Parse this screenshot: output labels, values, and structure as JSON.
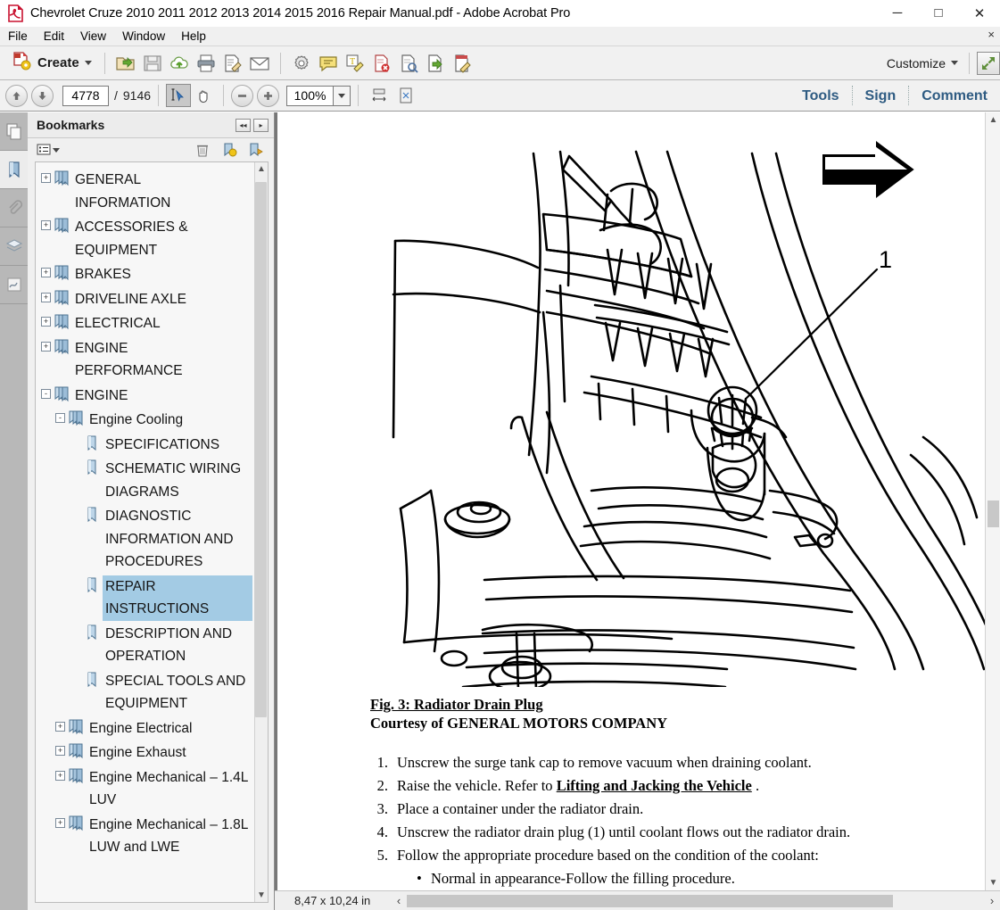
{
  "window": {
    "title": "Chevrolet Cruze 2010 2011 2012 2013 2014 2015 2016 Repair Manual.pdf - Adobe Acrobat Pro",
    "minimize": "─",
    "maximize": "□",
    "close": "✕"
  },
  "menubar": {
    "items": [
      {
        "label": "File"
      },
      {
        "label": "Edit"
      },
      {
        "label": "View"
      },
      {
        "label": "Window"
      },
      {
        "label": "Help"
      }
    ],
    "close_label": "×"
  },
  "toolbar": {
    "create_label": "Create",
    "customize_label": "Customize",
    "icons": [
      {
        "name": "open-file-icon"
      },
      {
        "name": "save-icon"
      },
      {
        "name": "upload-cloud-icon"
      },
      {
        "name": "print-icon"
      },
      {
        "name": "sign-document-icon"
      },
      {
        "name": "email-icon"
      },
      {
        "name": "gear-icon"
      },
      {
        "name": "comment-bubble-icon"
      },
      {
        "name": "highlight-text-icon"
      },
      {
        "name": "delete-page-icon"
      },
      {
        "name": "inspect-document-icon"
      },
      {
        "name": "export-document-icon"
      },
      {
        "name": "edit-document-icon"
      }
    ]
  },
  "navbar": {
    "page_current": "4778",
    "page_separator": "/",
    "page_total": "9146",
    "zoom_level": "100%",
    "links": [
      {
        "label": "Tools"
      },
      {
        "label": "Sign"
      },
      {
        "label": "Comment"
      }
    ]
  },
  "rail": {
    "items": [
      {
        "name": "page-thumbnails-icon"
      },
      {
        "name": "bookmarks-icon"
      },
      {
        "name": "attachments-icon"
      },
      {
        "name": "layers-icon"
      },
      {
        "name": "signatures-icon"
      }
    ]
  },
  "bookmarks": {
    "panel_title": "Bookmarks",
    "collapse_label": "◂◂",
    "expand_label": "▸",
    "toolbar": {
      "options_icon": "bookmark-options-icon",
      "delete_icon": "trash-icon",
      "new_bookmark_icon": "new-bookmark-icon",
      "goto_bookmark_icon": "goto-bookmark-icon"
    },
    "tree": [
      {
        "level": 1,
        "label": "GENERAL INFORMATION",
        "toggle": "+",
        "selected": false
      },
      {
        "level": 1,
        "label": "ACCESSORIES & EQUIPMENT",
        "toggle": "+",
        "selected": false
      },
      {
        "level": 1,
        "label": "BRAKES",
        "toggle": "+",
        "selected": false
      },
      {
        "level": 1,
        "label": "DRIVELINE AXLE",
        "toggle": "+",
        "selected": false
      },
      {
        "level": 1,
        "label": "ELECTRICAL",
        "toggle": "+",
        "selected": false
      },
      {
        "level": 1,
        "label": "ENGINE PERFORMANCE",
        "toggle": "+",
        "selected": false
      },
      {
        "level": 1,
        "label": "ENGINE",
        "toggle": "-",
        "selected": false
      },
      {
        "level": 2,
        "label": "Engine Cooling",
        "toggle": "-",
        "selected": false
      },
      {
        "level": 3,
        "label": "SPECIFICATIONS",
        "toggle": "",
        "selected": false
      },
      {
        "level": 3,
        "label": "SCHEMATIC WIRING DIAGRAMS",
        "toggle": "",
        "selected": false
      },
      {
        "level": 3,
        "label": "DIAGNOSTIC INFORMATION AND PROCEDURES",
        "toggle": "",
        "selected": false
      },
      {
        "level": 3,
        "label": "REPAIR INSTRUCTIONS",
        "toggle": "",
        "selected": true
      },
      {
        "level": 3,
        "label": "DESCRIPTION AND OPERATION",
        "toggle": "",
        "selected": false
      },
      {
        "level": 3,
        "label": "SPECIAL TOOLS AND EQUIPMENT",
        "toggle": "",
        "selected": false
      },
      {
        "level": 2,
        "label": "Engine Electrical",
        "toggle": "+",
        "selected": false
      },
      {
        "level": 2,
        "label": "Engine Exhaust",
        "toggle": "+",
        "selected": false
      },
      {
        "level": 2,
        "label": "Engine Mechanical – 1.4L LUV",
        "toggle": "+",
        "selected": false
      },
      {
        "level": 2,
        "label": "Engine Mechanical – 1.8L LUW and LWE",
        "toggle": "+",
        "selected": false
      }
    ]
  },
  "document": {
    "figure_label": "1",
    "figure_title": "Fig. 3: Radiator Drain Plug",
    "figure_courtesy": "Courtesy of GENERAL MOTORS COMPANY",
    "steps": [
      {
        "num": "1.",
        "text": "Unscrew the surge tank cap to remove vacuum when draining coolant.",
        "link": ""
      },
      {
        "num": "2.",
        "text": "Raise the vehicle. Refer to ",
        "link": "Lifting and Jacking the Vehicle",
        "after": " ."
      },
      {
        "num": "3.",
        "text": "Place a container under the radiator drain.",
        "link": ""
      },
      {
        "num": "4.",
        "text": "Unscrew the radiator drain plug (1) until coolant flows out the radiator drain.",
        "link": ""
      },
      {
        "num": "5.",
        "text": "Follow the appropriate procedure based on the condition of the coolant:",
        "link": ""
      }
    ],
    "substeps": [
      {
        "bullet": "•",
        "text": "Normal in appearance-Follow the filling procedure."
      }
    ]
  },
  "statusbar": {
    "page_size": "8,47 x 10,24 in",
    "scroll_left": "‹",
    "scroll_right": "›"
  },
  "colors": {
    "accent_link": "#2e5b82",
    "selection": "#a3cbe4",
    "toolbar_bg": "#f1f1f1",
    "rail_bg": "#b8b8b8"
  }
}
